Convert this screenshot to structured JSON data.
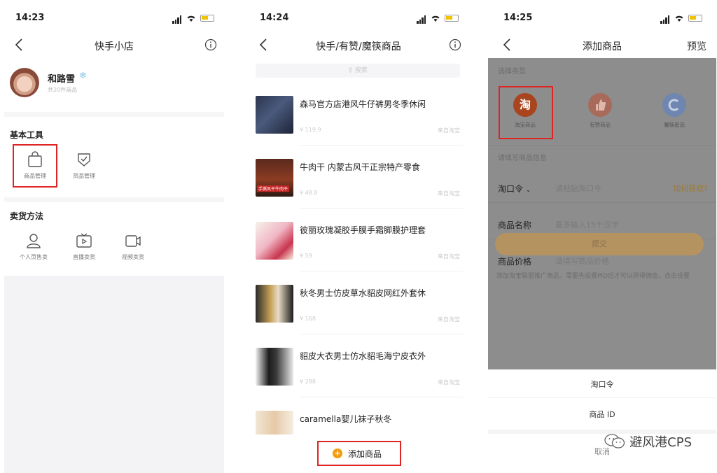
{
  "screen1": {
    "time": "14:23",
    "nav_title": "快手小店",
    "user_name": "和路雪",
    "user_sub": "共20件商品",
    "section_tools": "基本工具",
    "tools": [
      {
        "label": "商品管理",
        "icon": "bag-icon"
      },
      {
        "label": "货品管理",
        "icon": "shield-check-icon"
      }
    ],
    "section_sell": "卖货方法",
    "sell_methods": [
      {
        "label": "个人页售卖",
        "icon": "person-icon"
      },
      {
        "label": "直播卖货",
        "icon": "tv-play-icon"
      },
      {
        "label": "视频卖货",
        "icon": "video-camera-icon"
      }
    ]
  },
  "screen2": {
    "time": "14:24",
    "nav_title": "快手/有赞/魔筷商品",
    "search_placeholder": "搜索",
    "products": [
      {
        "title": "森马官方店港风牛仔裤男冬季休闲",
        "price": "¥ 119.9",
        "source": "来自淘宝"
      },
      {
        "title": "牛肉干 内蒙古风干正宗特产零食",
        "price": "¥ 48.8",
        "source": "来自淘宝",
        "thumb_text": "手撕风干牛肉干"
      },
      {
        "title": "彼丽玫瑰凝胶手膜手霜脚膜护理套",
        "price": "¥ 59",
        "source": "来自淘宝"
      },
      {
        "title": "秋冬男士仿皮草水貂皮网红外套休",
        "price": "¥ 168",
        "source": "来自淘宝"
      },
      {
        "title": "貂皮大衣男士仿水貂毛海宁皮衣外",
        "price": "¥ 288",
        "source": "来自淘宝"
      },
      {
        "title": "caramella婴儿袜子秋冬",
        "price": "",
        "source": ""
      }
    ],
    "add_button": "添加商品"
  },
  "screen3": {
    "time": "14:25",
    "nav_title": "添加商品",
    "nav_right": "预览",
    "select_type_label": "选择类型",
    "types": [
      {
        "label": "淘宝商品",
        "glyph": "淘",
        "color": "#a8451e"
      },
      {
        "label": "有赞商品",
        "glyph": "",
        "color": "#a86a5a"
      },
      {
        "label": "魔筷星选",
        "glyph": "",
        "color": "#6f86b0"
      }
    ],
    "fill_info_label": "请填写商品信息",
    "fields": [
      {
        "label": "淘口令",
        "placeholder": "请粘贴淘口令",
        "extra": "如何获取?"
      },
      {
        "label": "商品名称",
        "placeholder": "最多输入15个汉字"
      },
      {
        "label": "商品价格",
        "placeholder": "请填写商品价格"
      }
    ],
    "submit_label": "提交",
    "hint_text": "添加淘宝联盟推广商品，需要先设置PID后才可以获得佣金。点击设置",
    "sheet_items": [
      "淘口令",
      "商品 ID",
      "取消"
    ]
  },
  "watermark": "避风港CPS",
  "colors": {
    "highlight_red": "#e02424",
    "add_orange": "#f39c12",
    "taobao": "#a8451e"
  }
}
